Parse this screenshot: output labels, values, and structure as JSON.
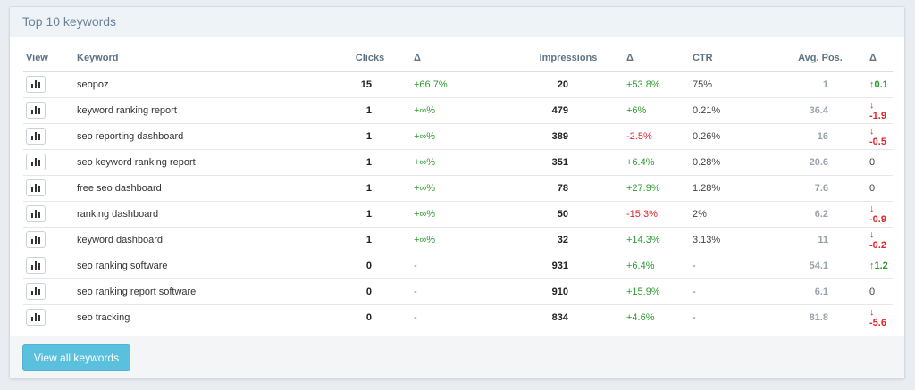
{
  "panel": {
    "title": "Top 10 keywords"
  },
  "table": {
    "headers": {
      "view": "View",
      "keyword": "Keyword",
      "clicks": "Clicks",
      "clicks_delta": "Δ",
      "impressions": "Impressions",
      "impressions_delta": "Δ",
      "ctr": "CTR",
      "avg_pos": "Avg. Pos.",
      "pos_delta": "Δ"
    },
    "rows": [
      {
        "keyword": "seopoz",
        "clicks": "15",
        "clicks_delta": "+66.7%",
        "impressions": "20",
        "impressions_delta": "+53.8%",
        "impressions_delta_dir": "up",
        "ctr": "75%",
        "avg_pos": "1",
        "pos_delta": "0.1",
        "pos_delta_dir": "up"
      },
      {
        "keyword": "keyword ranking report",
        "clicks": "1",
        "clicks_delta": "+∞%",
        "impressions": "479",
        "impressions_delta": "+6%",
        "impressions_delta_dir": "up",
        "ctr": "0.21%",
        "avg_pos": "36.4",
        "pos_delta": "-1.9",
        "pos_delta_dir": "down"
      },
      {
        "keyword": "seo reporting dashboard",
        "clicks": "1",
        "clicks_delta": "+∞%",
        "impressions": "389",
        "impressions_delta": "-2.5%",
        "impressions_delta_dir": "down",
        "ctr": "0.26%",
        "avg_pos": "16",
        "pos_delta": "-0.5",
        "pos_delta_dir": "down"
      },
      {
        "keyword": "seo keyword ranking report",
        "clicks": "1",
        "clicks_delta": "+∞%",
        "impressions": "351",
        "impressions_delta": "+6.4%",
        "impressions_delta_dir": "up",
        "ctr": "0.28%",
        "avg_pos": "20.6",
        "pos_delta": "0",
        "pos_delta_dir": "none"
      },
      {
        "keyword": "free seo dashboard",
        "clicks": "1",
        "clicks_delta": "+∞%",
        "impressions": "78",
        "impressions_delta": "+27.9%",
        "impressions_delta_dir": "up",
        "ctr": "1.28%",
        "avg_pos": "7.6",
        "pos_delta": "0",
        "pos_delta_dir": "none"
      },
      {
        "keyword": "ranking dashboard",
        "clicks": "1",
        "clicks_delta": "+∞%",
        "impressions": "50",
        "impressions_delta": "-15.3%",
        "impressions_delta_dir": "down",
        "ctr": "2%",
        "avg_pos": "6.2",
        "pos_delta": "-0.9",
        "pos_delta_dir": "down"
      },
      {
        "keyword": "keyword dashboard",
        "clicks": "1",
        "clicks_delta": "+∞%",
        "impressions": "32",
        "impressions_delta": "+14.3%",
        "impressions_delta_dir": "up",
        "ctr": "3.13%",
        "avg_pos": "11",
        "pos_delta": "-0.2",
        "pos_delta_dir": "down"
      },
      {
        "keyword": "seo ranking software",
        "clicks": "0",
        "clicks_delta": "-",
        "impressions": "931",
        "impressions_delta": "+6.4%",
        "impressions_delta_dir": "up",
        "ctr": "-",
        "avg_pos": "54.1",
        "pos_delta": "1.2",
        "pos_delta_dir": "up"
      },
      {
        "keyword": "seo ranking report software",
        "clicks": "0",
        "clicks_delta": "-",
        "impressions": "910",
        "impressions_delta": "+15.9%",
        "impressions_delta_dir": "up",
        "ctr": "-",
        "avg_pos": "6.1",
        "pos_delta": "0",
        "pos_delta_dir": "none"
      },
      {
        "keyword": "seo tracking",
        "clicks": "0",
        "clicks_delta": "-",
        "impressions": "834",
        "impressions_delta": "+4.6%",
        "impressions_delta_dir": "up",
        "ctr": "-",
        "avg_pos": "81.8",
        "pos_delta": "-5.6",
        "pos_delta_dir": "down"
      }
    ]
  },
  "icons": {
    "view": "bar-chart-icon",
    "up": "arrow-up-icon",
    "down": "arrow-down-icon"
  },
  "colors": {
    "positive": "#2e9b2e",
    "negative": "#e0262a",
    "button": "#5bc0de"
  },
  "footer": {
    "view_all_label": "View all keywords"
  }
}
